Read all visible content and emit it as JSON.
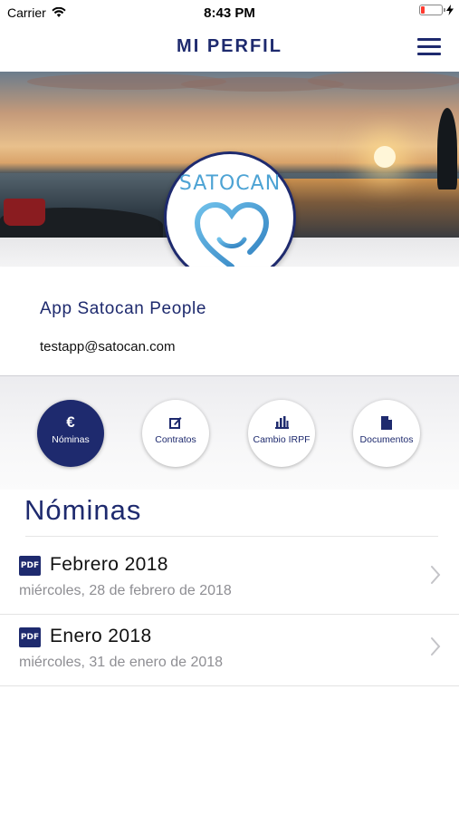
{
  "status_bar": {
    "carrier": "Carrier",
    "time": "8:43 PM",
    "battery_level": 0.2,
    "battery_color": "#ff3b30"
  },
  "nav": {
    "title": "MI PERFIL",
    "menu_icon": "hamburger-menu-icon"
  },
  "hero": {
    "logo_text": "SATOCAN",
    "logo_icon": "heart-smile-icon"
  },
  "profile": {
    "name": "App Satocan People",
    "email": "testapp@satocan.com"
  },
  "tabs": [
    {
      "label": "Nóminas",
      "icon": "euro-icon",
      "active": true
    },
    {
      "label": "Contratos",
      "icon": "edit-icon",
      "active": false
    },
    {
      "label": "Cambio IRPF",
      "icon": "bar-chart-icon",
      "active": false
    },
    {
      "label": "Documentos",
      "icon": "document-icon",
      "active": false
    }
  ],
  "section": {
    "title": "Nóminas"
  },
  "payslips": [
    {
      "icon_text": "PDF",
      "title": "Febrero 2018",
      "date": "miércoles, 28 de febrero de 2018"
    },
    {
      "icon_text": "PDF",
      "title": "Enero 2018",
      "date": "miércoles, 31 de enero de 2018"
    }
  ],
  "colors": {
    "brand_navy": "#1e2a6e",
    "logo_blue": "#4da3d4",
    "secondary_text": "#8e8e93"
  }
}
